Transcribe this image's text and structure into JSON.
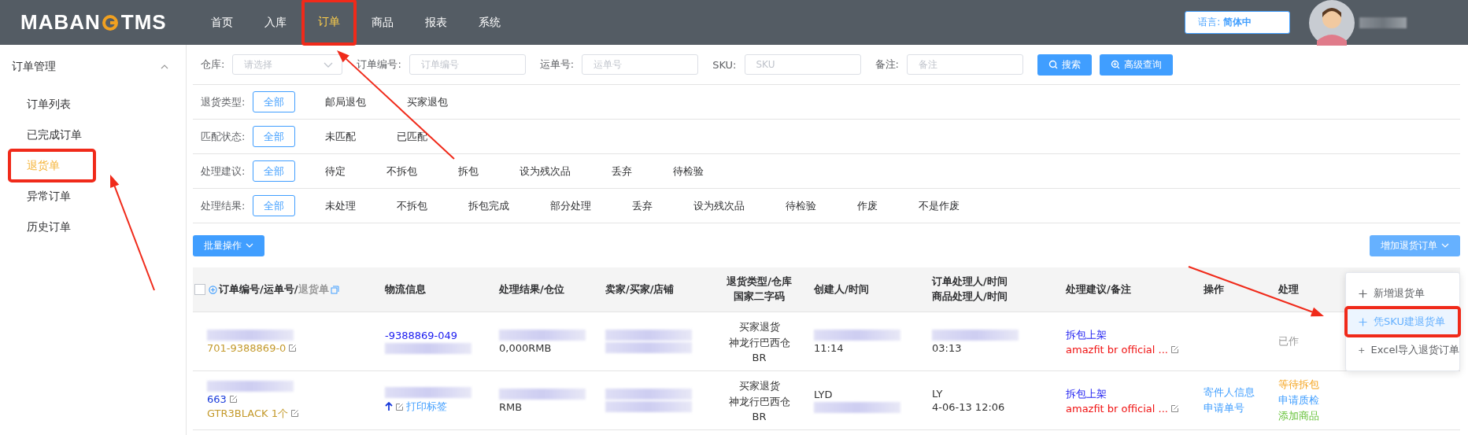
{
  "header": {
    "logo_left": "MABAN",
    "logo_right": "TMS",
    "nav": [
      {
        "label": "首页",
        "selected": false,
        "highlighted": false
      },
      {
        "label": "入库",
        "selected": false,
        "highlighted": false
      },
      {
        "label": "订单",
        "selected": true,
        "highlighted": true
      },
      {
        "label": "商品",
        "selected": false,
        "highlighted": false
      },
      {
        "label": "报表",
        "selected": false,
        "highlighted": false
      },
      {
        "label": "系统",
        "selected": false,
        "highlighted": false
      }
    ],
    "language": {
      "label": "语言:",
      "value": "简体中"
    }
  },
  "sidebar": {
    "group": "订单管理",
    "expanded": true,
    "items": [
      {
        "label": "订单列表",
        "selected": false,
        "highlighted": false
      },
      {
        "label": "已完成订单",
        "selected": false,
        "highlighted": false
      },
      {
        "label": "退货单",
        "selected": true,
        "highlighted": true
      },
      {
        "label": "异常订单",
        "selected": false,
        "highlighted": false
      },
      {
        "label": "历史订单",
        "selected": false,
        "highlighted": false
      }
    ]
  },
  "search": {
    "fields": [
      {
        "label": "仓库:",
        "placeholder": "请选择",
        "kind": "select"
      },
      {
        "label": "订单编号:",
        "placeholder": "订单编号",
        "kind": "input"
      },
      {
        "label": "运单号:",
        "placeholder": "运单号",
        "kind": "input"
      },
      {
        "label": "SKU:",
        "placeholder": "SKU",
        "kind": "input"
      },
      {
        "label": "备注:",
        "placeholder": "备注",
        "kind": "input"
      }
    ],
    "search_button": "搜索",
    "advanced_button": "高级查询"
  },
  "filter_groups": [
    {
      "label": "退货类型:",
      "options": [
        {
          "label": "全部",
          "selected": true
        },
        {
          "label": "邮局退包",
          "selected": false
        },
        {
          "label": "买家退包",
          "selected": false
        }
      ]
    },
    {
      "label": "匹配状态:",
      "options": [
        {
          "label": "全部",
          "selected": true
        },
        {
          "label": "未匹配",
          "selected": false
        },
        {
          "label": "已匹配",
          "selected": false
        }
      ]
    },
    {
      "label": "处理建议:",
      "options": [
        {
          "label": "全部",
          "selected": true
        },
        {
          "label": "待定",
          "selected": false
        },
        {
          "label": "不拆包",
          "selected": false
        },
        {
          "label": "拆包",
          "selected": false
        },
        {
          "label": "设为残次品",
          "selected": false
        },
        {
          "label": "丢弃",
          "selected": false
        },
        {
          "label": "待检验",
          "selected": false
        }
      ]
    },
    {
      "label": "处理结果:",
      "options": [
        {
          "label": "全部",
          "selected": true
        },
        {
          "label": "未处理",
          "selected": false
        },
        {
          "label": "不拆包",
          "selected": false
        },
        {
          "label": "拆包完成",
          "selected": false
        },
        {
          "label": "部分处理",
          "selected": false
        },
        {
          "label": "丢弃",
          "selected": false
        },
        {
          "label": "设为残次品",
          "selected": false
        },
        {
          "label": "待检验",
          "selected": false
        },
        {
          "label": "作废",
          "selected": false
        },
        {
          "label": "不是作废",
          "selected": false
        }
      ]
    }
  ],
  "toolbar": {
    "batch_button": "批量操作",
    "add_button": "增加退货订单",
    "add_menu": [
      {
        "label": "新增退货单",
        "hovered": false,
        "highlighted": false
      },
      {
        "label": "凭SKU建退货单",
        "hovered": true,
        "highlighted": true
      },
      {
        "label": "Excel导入退货订单",
        "hovered": false,
        "highlighted": false
      }
    ]
  },
  "table": {
    "select_all_checked": false,
    "columns": [
      {
        "label": "订单编号/运单号/",
        "suffix": "退货单"
      },
      {
        "label": "物流信息"
      },
      {
        "label": "处理结果/仓位"
      },
      {
        "label": "卖家/买家/店铺"
      },
      {
        "label": "退货类型/仓库",
        "label2": "国家二字码"
      },
      {
        "label": "创建人/时间"
      },
      {
        "label": "订单处理人/时间",
        "label2": "商品处理人/时间"
      },
      {
        "label": "处理建议/备注"
      },
      {
        "label": "操作"
      },
      {
        "label": "处理"
      }
    ],
    "rows": [
      {
        "cells": [
          [
            {
              "kind": "blur"
            },
            {
              "kind": "gold",
              "text": "701-9388869-0",
              "edit": true
            }
          ],
          [
            {
              "kind": "strong-link",
              "text": "-9388869-049"
            },
            {
              "kind": "blur"
            }
          ],
          [
            {
              "kind": "blur"
            },
            {
              "kind": "plain",
              "text": "0,000RMB"
            }
          ],
          [
            {
              "kind": "blur"
            },
            {
              "kind": "blur"
            }
          ],
          [
            {
              "kind": "plain",
              "text": "买家退货"
            },
            {
              "kind": "plain",
              "text": "神龙行巴西仓"
            },
            {
              "kind": "plain",
              "text": "BR"
            }
          ],
          [
            {
              "kind": "blur"
            },
            {
              "kind": "plain",
              "text": "11:14"
            }
          ],
          [
            {
              "kind": "blur"
            },
            {
              "kind": "plain",
              "text": "03:13"
            }
          ],
          [
            {
              "kind": "strong-link",
              "text": "拆包上架"
            },
            {
              "kind": "red",
              "text": "amazfit br official ...",
              "edit": true
            }
          ],
          [],
          [
            {
              "kind": "muted",
              "text": "已作"
            }
          ]
        ]
      },
      {
        "cells": [
          [
            {
              "kind": "blur"
            },
            {
              "kind": "link",
              "text": "663",
              "edit": true
            },
            {
              "kind": "gold",
              "text": "GTR3BLACK 1个",
              "edit": true
            }
          ],
          [
            {
              "kind": "blur"
            },
            {
              "kind": "action",
              "text": "打印标签",
              "edit": true,
              "arrow": true
            }
          ],
          [
            {
              "kind": "blur"
            },
            {
              "kind": "plain",
              "text": "RMB"
            }
          ],
          [
            {
              "kind": "blur"
            },
            {
              "kind": "blur"
            }
          ],
          [
            {
              "kind": "plain",
              "text": "买家退货"
            },
            {
              "kind": "plain",
              "text": "神龙行巴西仓"
            },
            {
              "kind": "plain",
              "text": "BR"
            }
          ],
          [
            {
              "kind": "plain",
              "text": "LYD"
            },
            {
              "kind": "blur"
            }
          ],
          [
            {
              "kind": "plain",
              "text": "LY"
            },
            {
              "kind": "plain",
              "text": "4-06-13 12:06"
            }
          ],
          [
            {
              "kind": "strong-link",
              "text": "拆包上架"
            },
            {
              "kind": "red",
              "text": "amazfit br official ...",
              "edit": true
            }
          ],
          [
            {
              "kind": "action",
              "text": "寄件人信息"
            },
            {
              "kind": "action",
              "text": "申请单号"
            }
          ],
          [
            {
              "kind": "orange",
              "text": "等待拆包"
            },
            {
              "kind": "action",
              "text": "申请质检"
            },
            {
              "kind": "green",
              "text": "添加商品"
            }
          ]
        ]
      }
    ]
  },
  "annotations": [
    {
      "kind": "nav"
    },
    {
      "kind": "sidebar"
    },
    {
      "kind": "menu"
    }
  ]
}
